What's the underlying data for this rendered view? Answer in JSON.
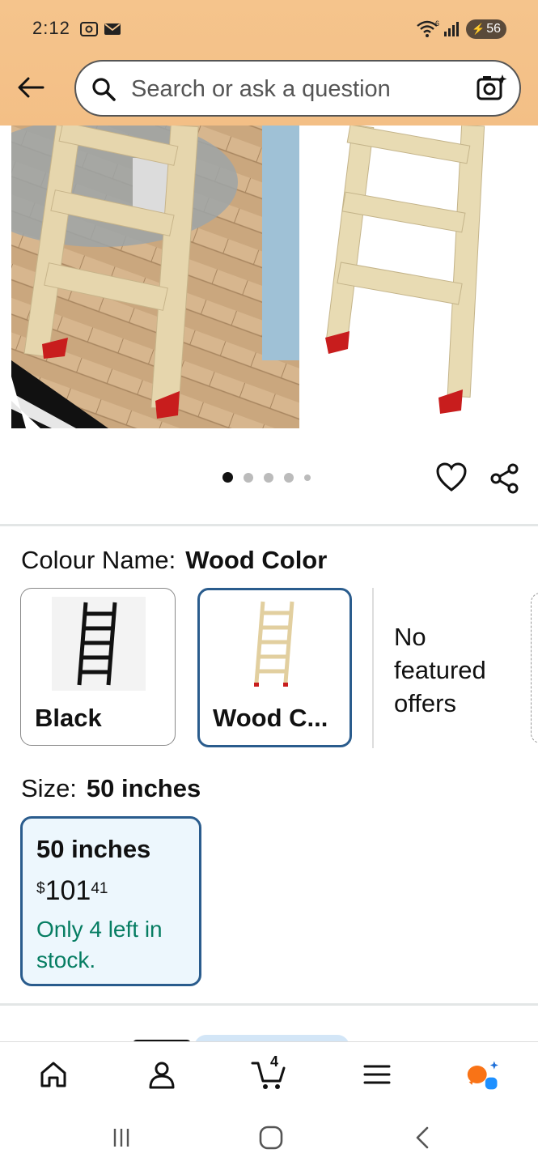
{
  "status_bar": {
    "time": "2:12",
    "battery": "56",
    "wifi_label": "6"
  },
  "search": {
    "placeholder": "Search or ask a question"
  },
  "gallery": {
    "image_count": 5,
    "active_index": 0
  },
  "variations": {
    "colour_label": "Colour Name:",
    "colour_selected": "Wood Color",
    "options": [
      {
        "label": "Black",
        "selected": false
      },
      {
        "label": "Wood C...",
        "selected": true
      }
    ],
    "no_offers": "No featured offers"
  },
  "size": {
    "label": "Size:",
    "selected": "50 inches",
    "option": {
      "name": "50 inches",
      "currency": "$",
      "price_whole": "101",
      "price_fraction": "41",
      "stock": "Only 4 left in stock."
    }
  },
  "bottom_nav": {
    "items": [
      "home",
      "account",
      "cart",
      "menu",
      "rufus"
    ],
    "cart_count": "4"
  },
  "colors": {
    "header_bg": "#f5c48c",
    "accent_blue": "#2a5c8d",
    "stock_green": "#067d62",
    "selected_bg": "#edf7fd"
  }
}
